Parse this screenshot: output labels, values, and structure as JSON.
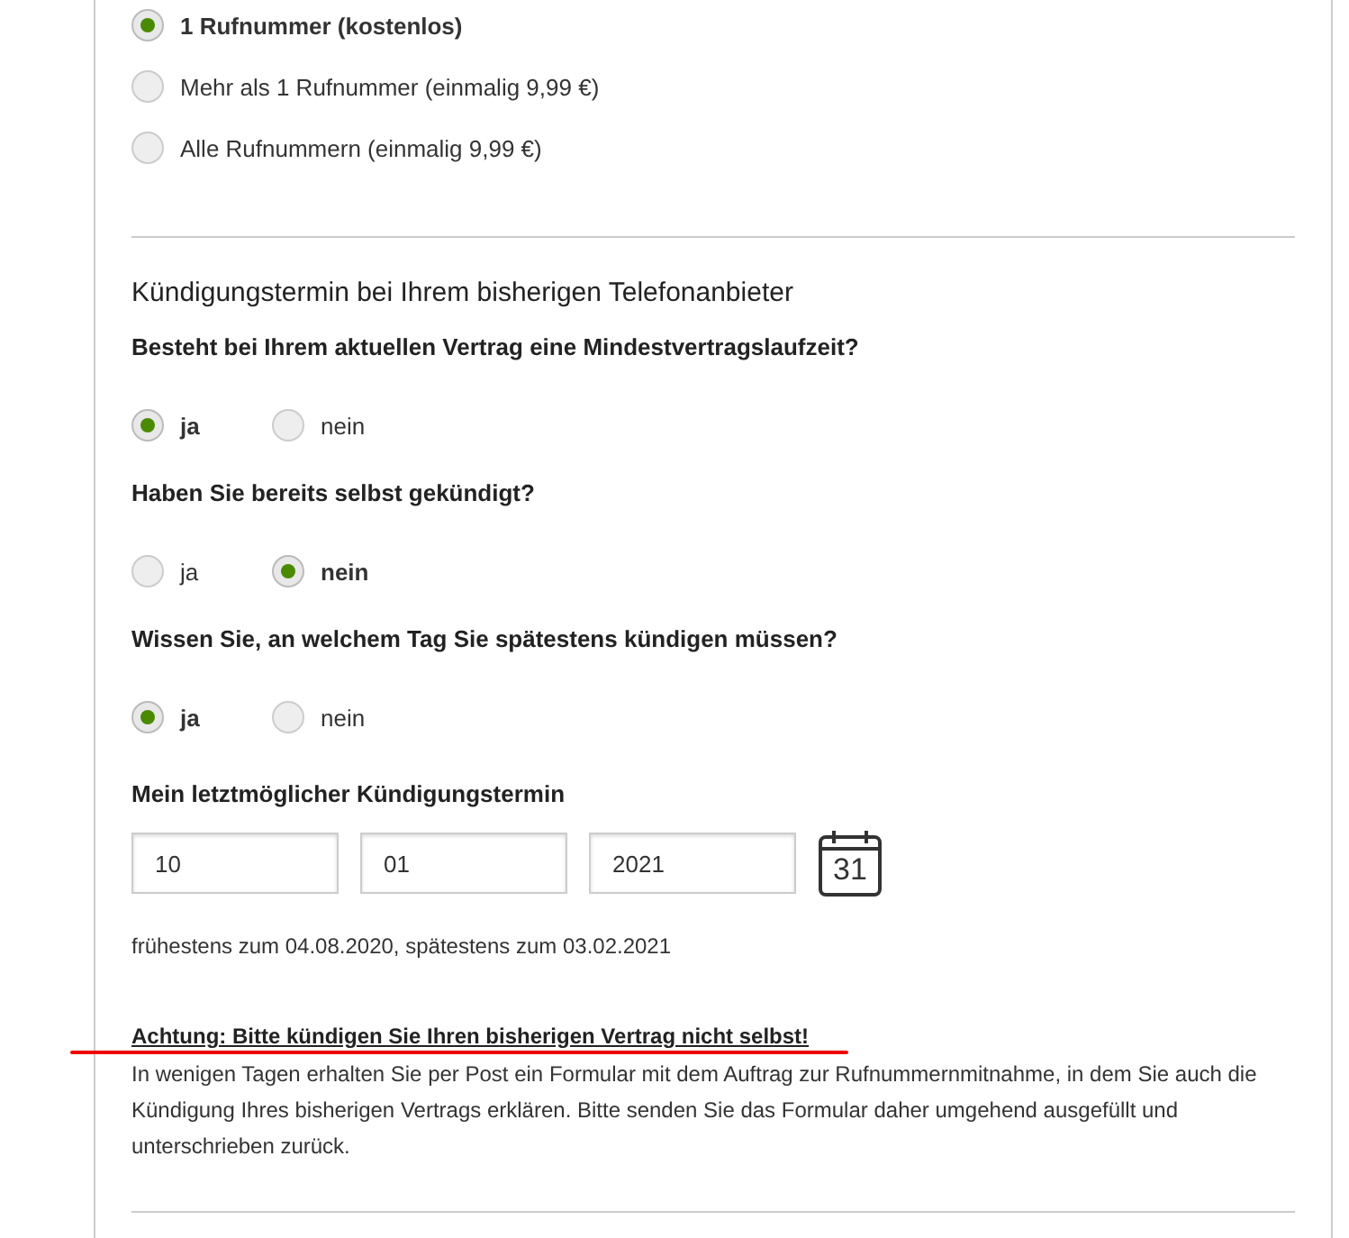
{
  "number_options": [
    {
      "label": "1 Rufnummer (kostenlos)",
      "selected": true
    },
    {
      "label": "Mehr als 1 Rufnummer (einmalig 9,99 €)",
      "selected": false
    },
    {
      "label": "Alle Rufnummern (einmalig 9,99 €)",
      "selected": false
    }
  ],
  "section": {
    "title": "Kündigungstermin bei Ihrem bisherigen Telefonanbieter",
    "questions": [
      {
        "question": "Besteht bei Ihrem aktuellen Vertrag eine Mindestvertragslaufzeit?",
        "options": [
          {
            "label": "ja",
            "selected": true
          },
          {
            "label": "nein",
            "selected": false
          }
        ]
      },
      {
        "question": "Haben Sie bereits selbst gekündigt?",
        "options": [
          {
            "label": "ja",
            "selected": false
          },
          {
            "label": "nein",
            "selected": true
          }
        ]
      },
      {
        "question": "Wissen Sie, an welchem Tag Sie spätestens kündigen müssen?",
        "options": [
          {
            "label": "ja",
            "selected": true
          },
          {
            "label": "nein",
            "selected": false
          }
        ]
      }
    ],
    "date": {
      "label": "Mein letztmöglicher Kündigungstermin",
      "day": "10",
      "month": "01",
      "year": "2021",
      "calendar_day": "31"
    },
    "hint": "frühestens zum 04.08.2020, spätestens zum 03.02.2021",
    "warning": {
      "title": "Achtung: Bitte kündigen Sie Ihren bisherigen Vertrag nicht selbst!",
      "text": "In wenigen Tagen erhalten Sie per Post ein Formular mit dem Auftrag zur Rufnummernmitnahme, in dem Sie auch die Kündigung Ihres bisherigen Vertrags erklären. Bitte senden Sie das Formular daher umgehend ausgefüllt und unterschrieben zurück."
    }
  }
}
